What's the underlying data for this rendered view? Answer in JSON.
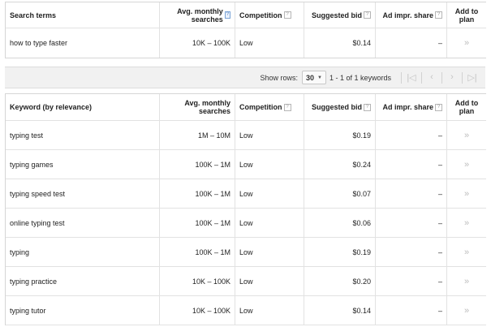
{
  "search_table": {
    "headers": {
      "term": "Search terms",
      "avg_searches": "Avg. monthly searches",
      "competition": "Competition",
      "suggested_bid": "Suggested bid",
      "ad_share": "Ad impr. share",
      "add_to_plan": "Add to plan"
    },
    "rows": [
      {
        "term": "how to type faster",
        "avg": "10K – 100K",
        "competition": "Low",
        "bid": "$0.14",
        "share": "–",
        "add": "»"
      }
    ]
  },
  "pagination": {
    "show_rows_label": "Show rows:",
    "rows_value": "30",
    "range_label": "1 - 1 of 1 keywords"
  },
  "keyword_table": {
    "headers": {
      "term": "Keyword (by relevance)",
      "avg_searches": "Avg. monthly searches",
      "competition": "Competition",
      "suggested_bid": "Suggested bid",
      "ad_share": "Ad impr. share",
      "add_to_plan": "Add to plan"
    },
    "rows": [
      {
        "term": "typing test",
        "avg": "1M – 10M",
        "competition": "Low",
        "bid": "$0.19",
        "share": "–",
        "add": "»"
      },
      {
        "term": "typing games",
        "avg": "100K – 1M",
        "competition": "Low",
        "bid": "$0.24",
        "share": "–",
        "add": "»"
      },
      {
        "term": "typing speed test",
        "avg": "100K – 1M",
        "competition": "Low",
        "bid": "$0.07",
        "share": "–",
        "add": "»"
      },
      {
        "term": "online typing test",
        "avg": "100K – 1M",
        "competition": "Low",
        "bid": "$0.06",
        "share": "–",
        "add": "»"
      },
      {
        "term": "typing",
        "avg": "100K – 1M",
        "competition": "Low",
        "bid": "$0.19",
        "share": "–",
        "add": "»"
      },
      {
        "term": "typing practice",
        "avg": "10K – 100K",
        "competition": "Low",
        "bid": "$0.20",
        "share": "–",
        "add": "»"
      },
      {
        "term": "typing tutor",
        "avg": "10K – 100K",
        "competition": "Low",
        "bid": "$0.14",
        "share": "–",
        "add": "»"
      }
    ]
  },
  "icons": {
    "help": "?",
    "dropdown": "▼",
    "first": "|◁",
    "prev": "‹",
    "next": "›",
    "last": "▷|"
  }
}
